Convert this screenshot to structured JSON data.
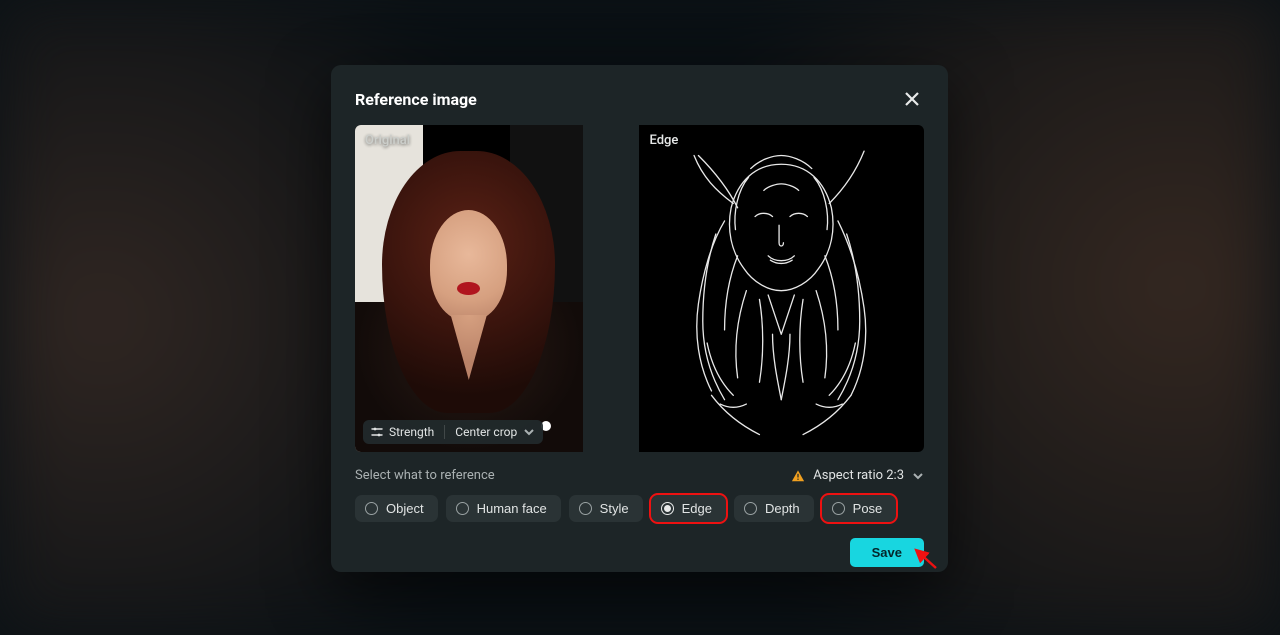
{
  "modal": {
    "title": "Reference image",
    "panels": {
      "original_label": "Original",
      "result_label": "Edge"
    },
    "overlay": {
      "strength": "Strength",
      "crop_mode": "Center crop"
    },
    "section_label": "Select what to reference",
    "aspect": {
      "label": "Aspect ratio 2:3"
    },
    "options": [
      {
        "key": "object",
        "label": "Object",
        "selected": false,
        "highlight": false
      },
      {
        "key": "human-face",
        "label": "Human face",
        "selected": false,
        "highlight": false
      },
      {
        "key": "style",
        "label": "Style",
        "selected": false,
        "highlight": false
      },
      {
        "key": "edge",
        "label": "Edge",
        "selected": true,
        "highlight": true
      },
      {
        "key": "depth",
        "label": "Depth",
        "selected": false,
        "highlight": false
      },
      {
        "key": "pose",
        "label": "Pose",
        "selected": false,
        "highlight": true
      }
    ],
    "save_label": "Save"
  }
}
